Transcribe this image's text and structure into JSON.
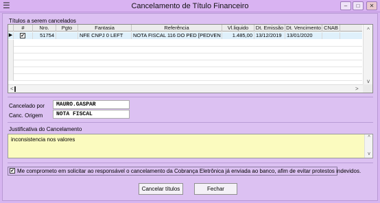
{
  "window": {
    "title": "Cancelamento de Título Financeiro",
    "menu_icon": "hamburger-icon"
  },
  "grid": {
    "group_label": "Títulos a serem cancelados",
    "columns": [
      "#",
      "Nro.",
      "Pgto",
      "Fantasia",
      "Referência",
      "Vl.liquido",
      "Dt. Emissão",
      "Dt. Vencimento",
      "CNAB"
    ],
    "rows": [
      {
        "checked": true,
        "nro": "51754",
        "pgto": "",
        "fantasia": "NFE CNPJ 0 LEFT",
        "referencia": "NOTA FISCAL 116 DO PED [PEDVEN",
        "vl_liquido": "1.485,00",
        "dt_emissao": "13/12/2019",
        "dt_vencimento": "13/01/2020",
        "cnab": ""
      }
    ]
  },
  "cancel_info": {
    "cancelado_por_label": "Cancelado por",
    "cancelado_por_value": "MAURO.GASPAR",
    "canc_origem_label": "Canc. Origem",
    "canc_origem_value": "NOTA FISCAL"
  },
  "justificativa": {
    "label": "Justificativa do Cancelamento",
    "text": "inconsistencia nos valores",
    "background": "#fbfbbf"
  },
  "agreement": {
    "checked": true,
    "text": "Me comprometo em solicitar ao responsável o cancelamento da Cobrança Eletrônica já enviada ao banco, afim de evitar protestos indevidos."
  },
  "buttons": {
    "cancel_label": "Cancelar títulos",
    "close_label": "Fechar"
  },
  "colors": {
    "window_bg": "#dcc1f2",
    "selected_row": "#dff0fb"
  }
}
